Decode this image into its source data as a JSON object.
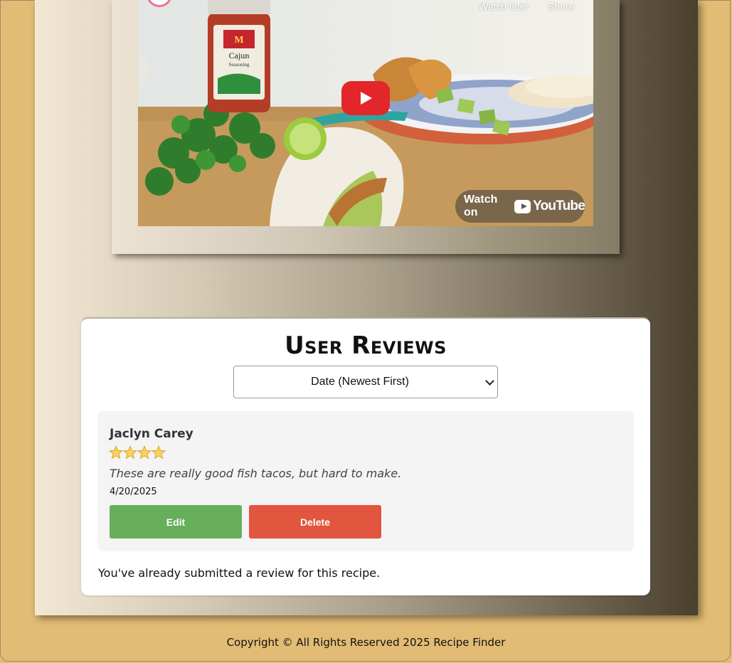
{
  "video": {
    "watch_later_label": "Watch later",
    "share_label": "Share",
    "watch_on_label": "Watch on",
    "youtube_label": "YouTube",
    "spice_brand": "McCormick",
    "spice_name": "Cajun",
    "spice_sub": "Seasoning"
  },
  "reviews": {
    "title": "User Reviews",
    "sort_selected": "Date (Newest First)",
    "items": [
      {
        "name": "Jaclyn Carey",
        "rating": 4,
        "text": "These are really good fish tacos, but hard to make.",
        "date": "4/20/2025",
        "edit_label": "Edit",
        "delete_label": "Delete"
      }
    ],
    "already_submitted": "You've already submitted a review for this recipe."
  },
  "footer": {
    "copyright": "Copyright © All Rights Reserved 2025 Recipe Finder"
  },
  "colors": {
    "page_background": "#e2bc74",
    "edit_button": "#67ae5b",
    "delete_button": "#e2553f",
    "youtube_red": "#e3262a",
    "star": "#f5c53a"
  }
}
